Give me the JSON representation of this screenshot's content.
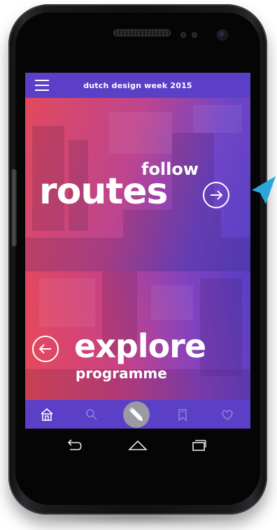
{
  "app_bar": {
    "title": "dutch design week 2015"
  },
  "routes_panel": {
    "small_label": "follow",
    "big_label": "routes"
  },
  "explore_panel": {
    "big_label": "explore",
    "small_label": "programme"
  },
  "bottom_nav": {
    "items": [
      "home-icon",
      "search-icon",
      "pencil-icon",
      "bookmark-icon",
      "heart-icon"
    ]
  },
  "colors": {
    "brand_purple": "#5b3fc6",
    "accent_red": "#ee4a54",
    "accent_blue": "#2aa6d8"
  }
}
